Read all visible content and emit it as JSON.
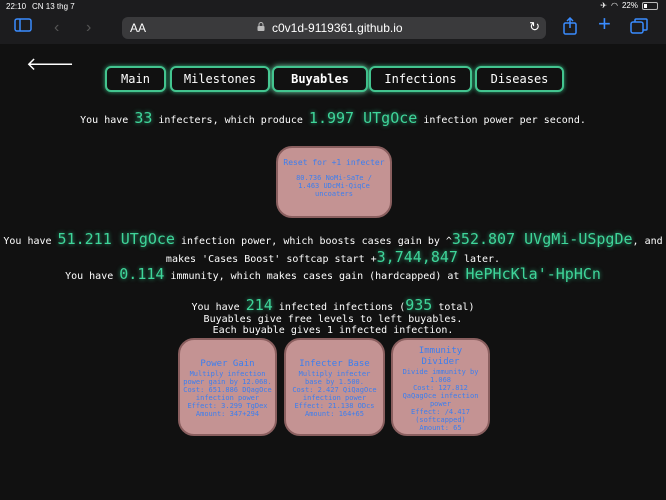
{
  "status_bar": {
    "time": "22:10",
    "date": "CN 13 thg 7",
    "battery": "22%",
    "battery_level": 0.22
  },
  "browser": {
    "text_size_label": "AA",
    "url": "c0v1d-9119361.github.io"
  },
  "tabs": [
    "Main",
    "Milestones",
    "Buyables",
    "Infections",
    "Diseases"
  ],
  "active_tab": "Buyables",
  "infecters_line": {
    "p1": "You have ",
    "count": "33",
    "p2": " infecters, which produce ",
    "power": "1.997 UTgOce",
    "p3": " infection power per second."
  },
  "reset_button": {
    "title": "Reset for +1 infecter",
    "req1": "80.736 NoMi-SaTe /",
    "req2": "1.463 UDcMi-QiqCe",
    "req3": "uncoaters"
  },
  "power_line": {
    "p1": "You have ",
    "value": "51.211 UTgOce",
    "p2": " infection power, which boosts cases gain by ^",
    "boost": "352.807 UVgMi-USpgDe",
    "p3": ", and"
  },
  "softcap_line": {
    "p1": "makes 'Cases Boost' softcap start +",
    "value": "3,744,847",
    "p2": " later."
  },
  "immunity_line": {
    "p1": "You have ",
    "value": "0.114",
    "p2": " immunity, which makes cases gain (hardcapped) at ",
    "cap": "HePHcKla'-HpHCn"
  },
  "infected_line": {
    "p1": "You have ",
    "value": "214",
    "p2": " infected infections (",
    "total": "935",
    "p3": " total)"
  },
  "info1": "Buyables give free levels to left buyables.",
  "info2": "Each buyable gives 1 infected infection.",
  "buyables": [
    {
      "title": "Power Gain",
      "l1": "Multiply infection",
      "l2": "power gain by 12.068.",
      "l3": "Cost: 651.886 DQagOce",
      "l4": "infection power",
      "l5": "Effect: 3.299 TgDex",
      "l6": "Amount: 347+294"
    },
    {
      "title": "Infecter Base",
      "l1": "Multiply infecter",
      "l2": "base by 1.500.",
      "l3": "Cost: 2.427 QiQagOce",
      "l4": "infection power",
      "l5": "Effect: 21.138 ODcs",
      "l6": "Amount: 164+65"
    },
    {
      "title": "Immunity Divider",
      "l1": "Divide immunity by",
      "l2": "1.068",
      "l3": "Cost: 127.812",
      "l4": "QaQagOce infection",
      "l5": "power",
      "l6": "Effect: /4.417",
      "l7": "(softcapped)",
      "l8": "Amount: 65"
    }
  ]
}
